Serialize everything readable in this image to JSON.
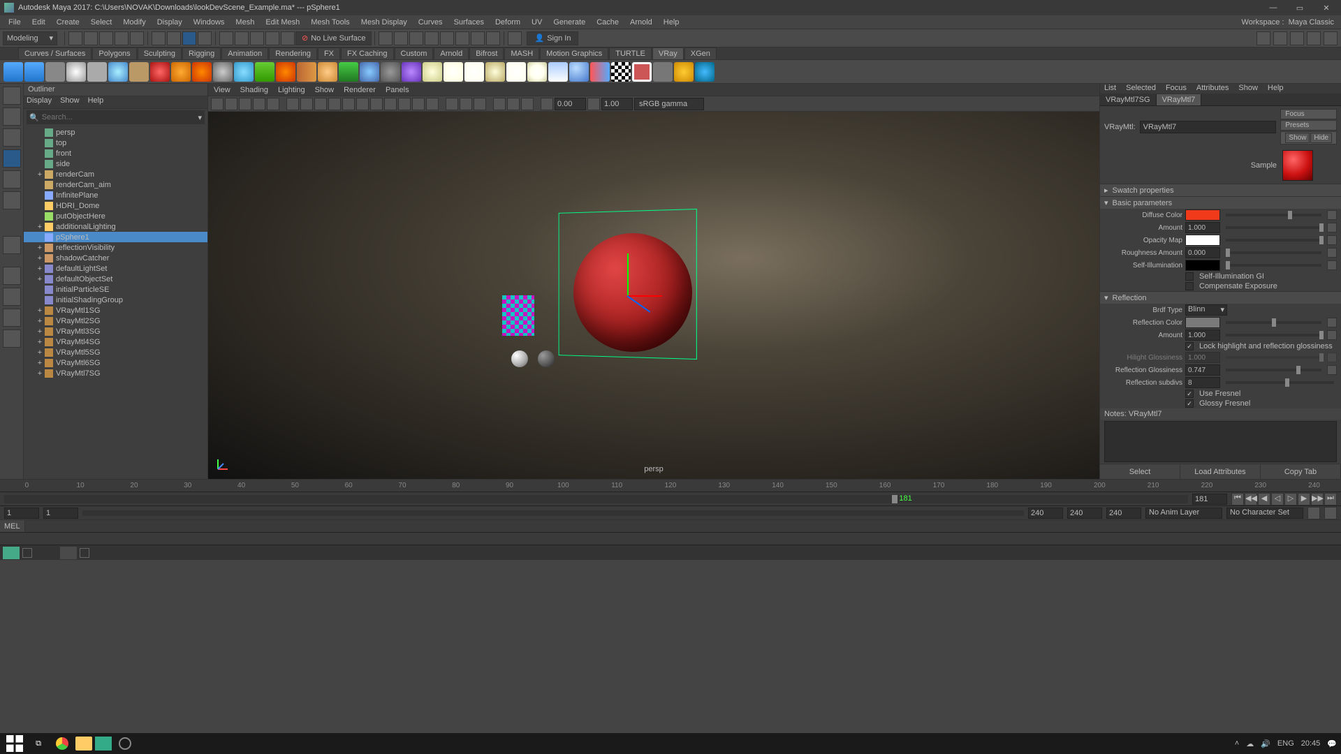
{
  "title": "Autodesk Maya 2017: C:\\Users\\NOVAK\\Downloads\\lookDevScene_Example.ma*  ---  pSphere1",
  "menubar": [
    "File",
    "Edit",
    "Create",
    "Select",
    "Modify",
    "Display",
    "Windows",
    "Mesh",
    "Edit Mesh",
    "Mesh Tools",
    "Mesh Display",
    "Curves",
    "Surfaces",
    "Deform",
    "UV",
    "Generate",
    "Cache",
    "Arnold",
    "Help"
  ],
  "workspace_label": "Workspace :",
  "workspace_value": "Maya Classic",
  "mode": "Modeling",
  "nolive": "No Live Surface",
  "signin": "Sign In",
  "shelf_tabs": [
    "Curves / Surfaces",
    "Polygons",
    "Sculpting",
    "Rigging",
    "Animation",
    "Rendering",
    "FX",
    "FX Caching",
    "Custom",
    "Arnold",
    "Bifrost",
    "MASH",
    "Motion Graphics",
    "TURTLE",
    "VRay",
    "XGen"
  ],
  "shelf_active": "VRay",
  "outliner": {
    "title": "Outliner",
    "menu": [
      "Display",
      "Show",
      "Help"
    ],
    "search_placeholder": "Search...",
    "nodes": [
      {
        "label": "persp",
        "icon": "#6a8",
        "exp": ""
      },
      {
        "label": "top",
        "icon": "#6a8",
        "exp": ""
      },
      {
        "label": "front",
        "icon": "#6a8",
        "exp": ""
      },
      {
        "label": "side",
        "icon": "#6a8",
        "exp": ""
      },
      {
        "label": "renderCam",
        "icon": "#ca6",
        "exp": "+"
      },
      {
        "label": "renderCam_aim",
        "icon": "#ca6",
        "exp": ""
      },
      {
        "label": "InfinitePlane",
        "icon": "#8af",
        "exp": ""
      },
      {
        "label": "HDRI_Dome",
        "icon": "#fc6",
        "exp": ""
      },
      {
        "label": "putObjectHere",
        "icon": "#9d6",
        "exp": ""
      },
      {
        "label": "additionalLighting",
        "icon": "#fc6",
        "exp": "+"
      },
      {
        "label": "pSphere1",
        "icon": "#8af",
        "exp": "",
        "sel": true
      },
      {
        "label": "reflectionVisibility",
        "icon": "#c96",
        "exp": "+"
      },
      {
        "label": "shadowCatcher",
        "icon": "#c96",
        "exp": "+"
      },
      {
        "label": "defaultLightSet",
        "icon": "#88c",
        "exp": "+"
      },
      {
        "label": "defaultObjectSet",
        "icon": "#88c",
        "exp": "+"
      },
      {
        "label": "initialParticleSE",
        "icon": "#88c",
        "exp": ""
      },
      {
        "label": "initialShadingGroup",
        "icon": "#88c",
        "exp": ""
      },
      {
        "label": "VRayMtl1SG",
        "icon": "#b84",
        "exp": "+"
      },
      {
        "label": "VRayMtl2SG",
        "icon": "#b84",
        "exp": "+"
      },
      {
        "label": "VRayMtl3SG",
        "icon": "#b84",
        "exp": "+"
      },
      {
        "label": "VRayMtl4SG",
        "icon": "#b84",
        "exp": "+"
      },
      {
        "label": "VRayMtl5SG",
        "icon": "#b84",
        "exp": "+"
      },
      {
        "label": "VRayMtl6SG",
        "icon": "#b84",
        "exp": "+"
      },
      {
        "label": "VRayMtl7SG",
        "icon": "#b84",
        "exp": "+"
      }
    ]
  },
  "viewport": {
    "menu": [
      "View",
      "Shading",
      "Lighting",
      "Show",
      "Renderer",
      "Panels"
    ],
    "exposure": "0.00",
    "gamma_val": "1.00",
    "gamma": "sRGB gamma",
    "name": "persp"
  },
  "attr": {
    "menu": [
      "List",
      "Selected",
      "Focus",
      "Attributes",
      "Show",
      "Help"
    ],
    "tabs": [
      "VRayMtl7SG",
      "VRayMtl7"
    ],
    "active_tab": "VRayMtl7",
    "type_label": "VRayMtl:",
    "name": "VRayMtl7",
    "btns": {
      "focus": "Focus",
      "presets": "Presets",
      "show": "Show",
      "hide": "Hide"
    },
    "sample_label": "Sample",
    "sections": {
      "swatch": "Swatch properties",
      "basic": "Basic parameters",
      "reflection": "Reflection"
    },
    "basic": {
      "diffuse_color_label": "Diffuse Color",
      "diffuse_color": "#f03a1a",
      "amount_label": "Amount",
      "amount": "1.000",
      "opacity_label": "Opacity Map",
      "opacity": "#ffffff",
      "rough_label": "Roughness Amount",
      "rough": "0.000",
      "self_label": "Self-Illumination",
      "self": "#000000",
      "self_gi": "Self-Illumination GI",
      "comp_exp": "Compensate Exposure"
    },
    "reflection": {
      "brdf_label": "Brdf Type",
      "brdf": "Blinn",
      "color_label": "Reflection Color",
      "color": "#7a7a7a",
      "amount_label": "Amount",
      "amount": "1.000",
      "lock": "Lock highlight and reflection glossiness",
      "hil_label": "Hilight Glossiness",
      "hil": "1.000",
      "rgl_label": "Reflection Glossiness",
      "rgl": "0.747",
      "sub_label": "Reflection subdivs",
      "sub": "8",
      "fresnel": "Use Fresnel",
      "glossy": "Glossy Fresnel"
    },
    "notes_label": "Notes: VRayMtl7",
    "bottom": {
      "select": "Select",
      "load": "Load Attributes",
      "copy": "Copy Tab"
    }
  },
  "time": {
    "ticks": [
      "0",
      "10",
      "20",
      "30",
      "40",
      "50",
      "60",
      "70",
      "80",
      "90",
      "100",
      "110",
      "120",
      "130",
      "140",
      "150",
      "160",
      "170",
      "180",
      "190",
      "200",
      "210",
      "220",
      "230",
      "240"
    ],
    "cur": "181",
    "cur2": "181"
  },
  "range": {
    "a": "1",
    "b": "1",
    "c": "240",
    "d": "240",
    "e": "240",
    "anim": "No Anim Layer",
    "char": "No Character Set"
  },
  "cmd": "MEL",
  "taskbar": {
    "lang": "ENG",
    "time": "20:45"
  }
}
